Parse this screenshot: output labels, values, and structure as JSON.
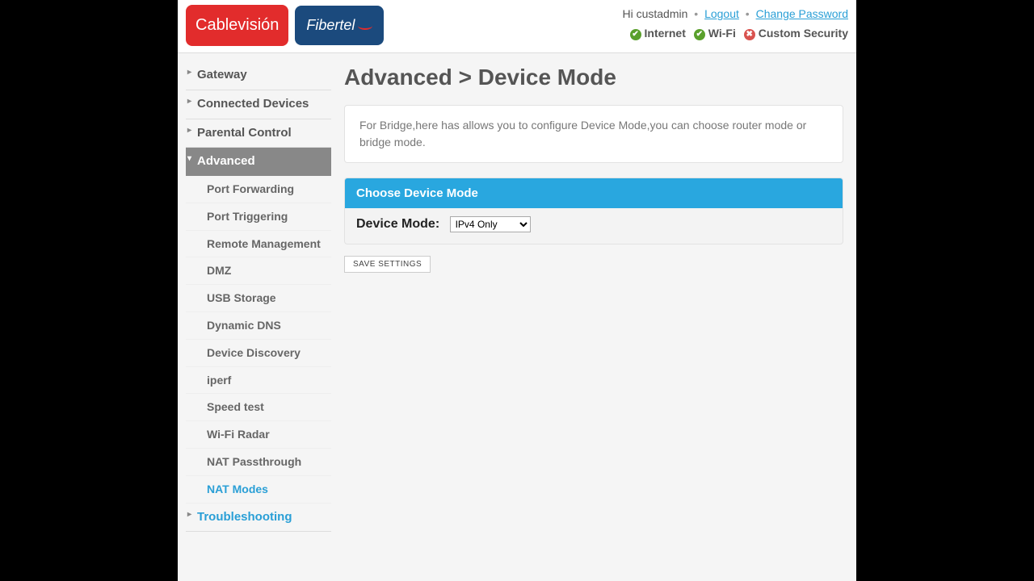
{
  "header": {
    "logo1": "Cablevisión",
    "logo2": "Fibertel",
    "greeting": "Hi custadmin",
    "logout": "Logout",
    "change_password": "Change Password",
    "status_internet": "Internet",
    "status_wifi": "Wi-Fi",
    "status_custom": "Custom Security"
  },
  "sidebar": {
    "gateway": "Gateway",
    "connected": "Connected Devices",
    "parental": "Parental Control",
    "advanced": "Advanced",
    "subs": {
      "port_forwarding": "Port Forwarding",
      "port_triggering": "Port Triggering",
      "remote_mgmt": "Remote Management",
      "dmz": "DMZ",
      "usb": "USB Storage",
      "ddns": "Dynamic DNS",
      "device_discovery": "Device Discovery",
      "iperf": "iperf",
      "speed_test": "Speed test",
      "wifi_radar": "Wi-Fi Radar",
      "nat_passthrough": "NAT Passthrough",
      "nat_modes": "NAT Modes"
    },
    "troubleshooting": "Troubleshooting"
  },
  "main": {
    "title": "Advanced > Device Mode",
    "description": "For Bridge,here has allows you to configure Device Mode,you can choose router mode or bridge mode.",
    "panel_title": "Choose Device Mode",
    "field_label": "Device Mode:",
    "select_value": "IPv4 Only",
    "save_button": "SAVE SETTINGS"
  }
}
